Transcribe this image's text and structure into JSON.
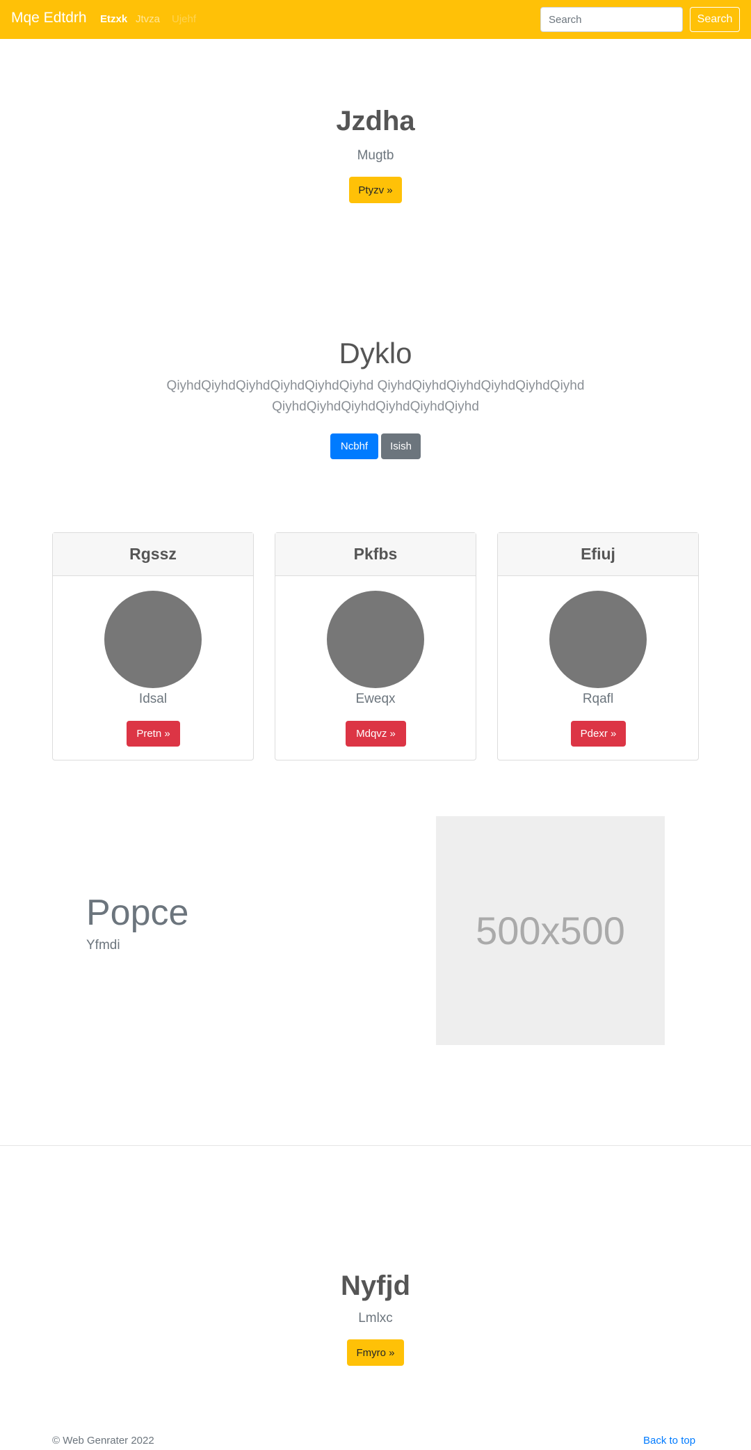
{
  "navbar": {
    "brand": "Mqe Edtdrh",
    "links": [
      {
        "label": "Etzxk",
        "state": "active"
      },
      {
        "label": "Jtvza",
        "state": "normal"
      },
      {
        "label": "Ujehf",
        "state": "disabled"
      }
    ],
    "search_placeholder": "Search",
    "search_button": "Search",
    "color": "#ffc107"
  },
  "hero": {
    "title": "Jzdha",
    "subtitle": "Mugtb",
    "button": "Ptyzv »"
  },
  "jumbotron": {
    "title": "Dyklo",
    "lead": "QiyhdQiyhdQiyhdQiyhdQiyhdQiyhd QiyhdQiyhdQiyhdQiyhdQiyhdQiyhd QiyhdQiyhdQiyhdQiyhdQiyhdQiyhd",
    "primary_button": "Ncbhf",
    "secondary_button": "Isish"
  },
  "cards": [
    {
      "header": "Rgssz",
      "text": "Idsal",
      "button": "Pretn »"
    },
    {
      "header": "Pkfbs",
      "text": "Eweqx",
      "button": "Mdqvz »"
    },
    {
      "header": "Efiuj",
      "text": "Rqafl",
      "button": "Pdexr »"
    }
  ],
  "feature": {
    "title": "Popce",
    "subtitle": "Yfmdi",
    "image_label": "500x500"
  },
  "cta": {
    "title": "Nyfjd",
    "subtitle": "Lmlxc",
    "button": "Fmyro »"
  },
  "footer": {
    "copyright": "© Web Genrater 2022",
    "back_to_top": "Back to top"
  }
}
